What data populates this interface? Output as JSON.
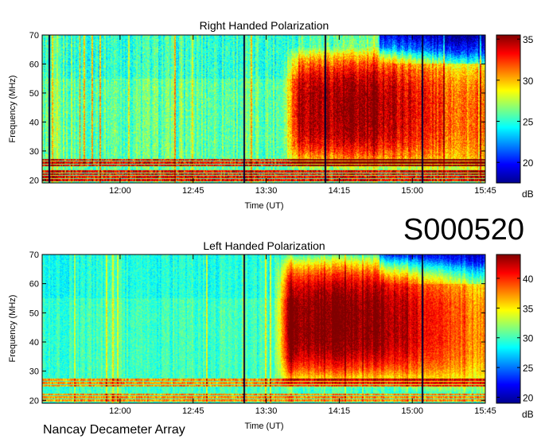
{
  "figure": {
    "id_label": "S000520",
    "footer": "Nancay Decameter Array"
  },
  "chart_data": [
    {
      "type": "heatmap",
      "title": "Right Handed Polarization",
      "xlabel": "Time (UT)",
      "ylabel": "Frequency (MHz)",
      "x_tick_labels": [
        "12:00",
        "12:45",
        "13:30",
        "14:15",
        "15:00",
        "15:45"
      ],
      "x_ticks_minutes_ut": [
        720,
        765,
        810,
        855,
        900,
        945
      ],
      "xlim_minutes_ut": [
        672,
        945
      ],
      "y_ticks": [
        20,
        30,
        40,
        50,
        60,
        70
      ],
      "ylim": [
        19,
        70
      ],
      "colorbar": {
        "unit": "dB",
        "ticks": [
          20,
          25,
          30,
          35
        ],
        "range": [
          17.5,
          35.5
        ],
        "colormap": "jet"
      },
      "features": {
        "burst_region_minutes_ut": [
          830,
          940
        ],
        "burst_region_freq_mhz": [
          27,
          62
        ],
        "burst_peak_db": 34,
        "background_db": 26,
        "rfi_band_freqs_mhz": [
          20,
          21,
          22,
          23,
          25,
          26,
          27
        ],
        "dark_vertical_lines_minutes_ut": [
          676,
          796,
          846,
          906
        ]
      }
    },
    {
      "type": "heatmap",
      "title": "Left Handed Polarization",
      "xlabel": "Time (UT)",
      "ylabel": "Frequency (MHz)",
      "x_tick_labels": [
        "12:00",
        "12:45",
        "13:30",
        "14:15",
        "15:00",
        "15:45"
      ],
      "x_ticks_minutes_ut": [
        720,
        765,
        810,
        855,
        900,
        945
      ],
      "xlim_minutes_ut": [
        672,
        945
      ],
      "y_ticks": [
        20,
        30,
        40,
        50,
        60,
        70
      ],
      "ylim": [
        19,
        70
      ],
      "colorbar": {
        "unit": "dB",
        "ticks": [
          20,
          25,
          30,
          35,
          40
        ],
        "range": [
          19,
          44
        ],
        "colormap": "jet"
      },
      "features": {
        "burst_region_minutes_ut": [
          825,
          940
        ],
        "burst_region_freq_mhz": [
          28,
          66
        ],
        "burst_peak_db": 43,
        "background_db": 30,
        "rfi_band_freqs_mhz": [
          20,
          21,
          22,
          25,
          26,
          27
        ],
        "dark_vertical_lines_minutes_ut": [
          796,
          906
        ]
      }
    }
  ]
}
